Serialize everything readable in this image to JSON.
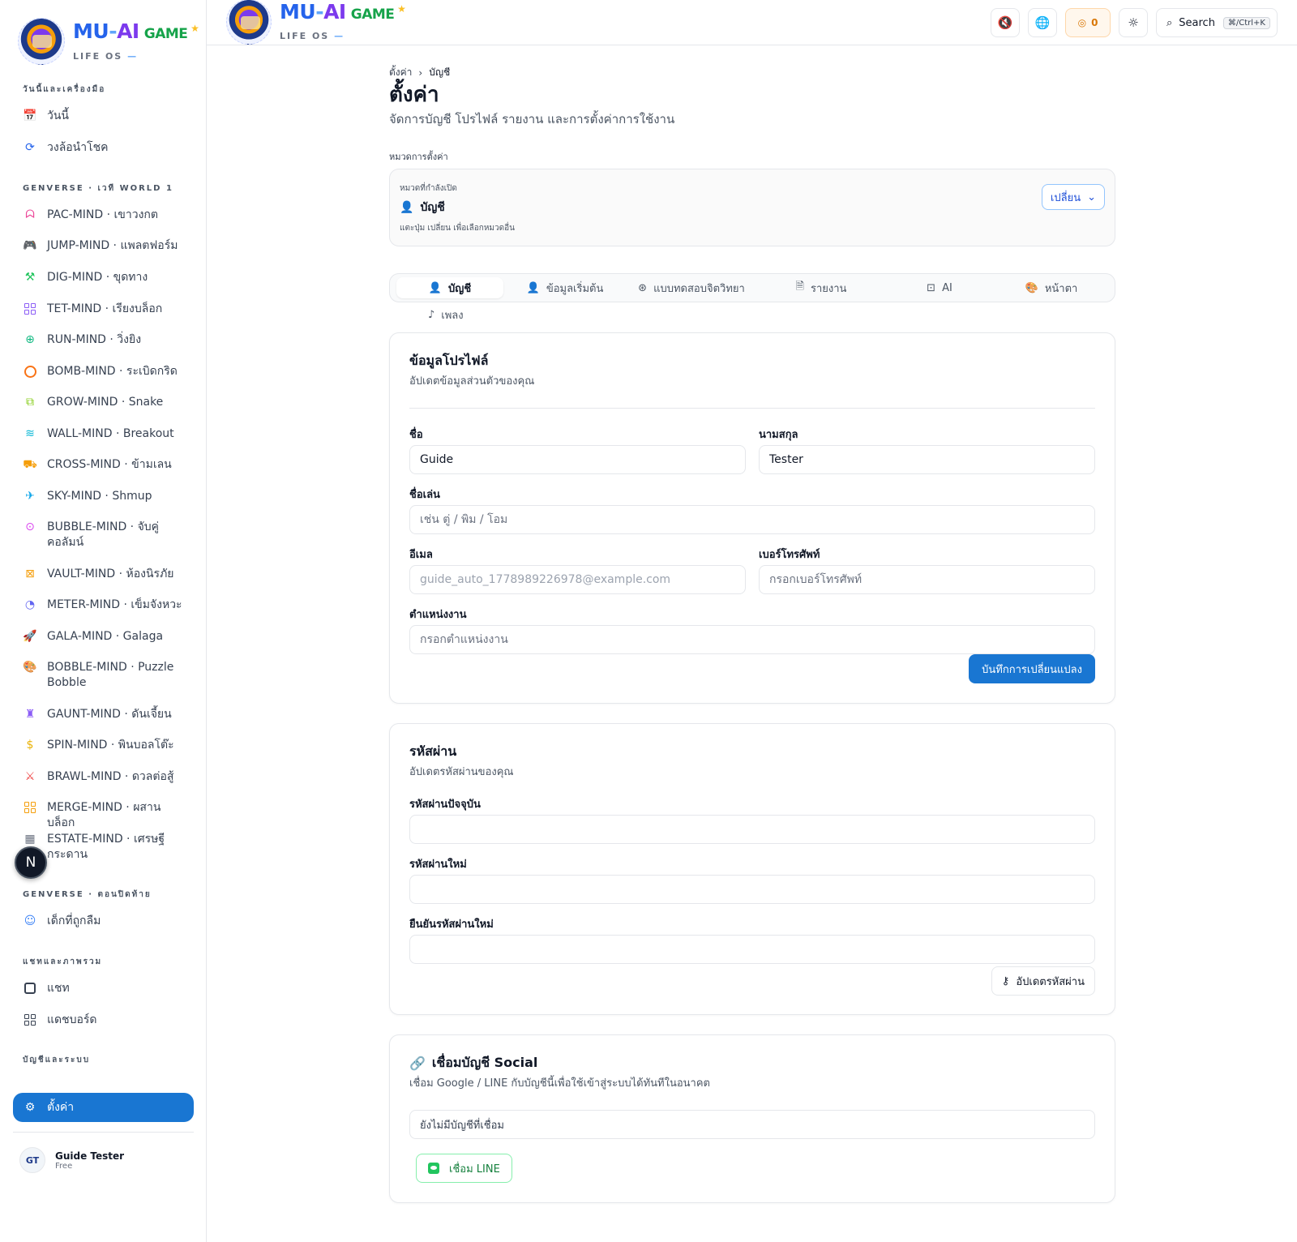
{
  "logo": {
    "mu": "MU",
    "dash": "-",
    "ai": "AI",
    "game": "GAME",
    "sub": "LIFE OS",
    "sub_dash": "—"
  },
  "sidebar": {
    "sections": [
      {
        "label": "วันนี้และเครื่องมือ"
      },
      {
        "label": "GENVERSE · เวที WORLD 1"
      },
      {
        "label": "GENVERSE · ตอนปิดท้าย"
      },
      {
        "label": "แชทและภาพรวม"
      },
      {
        "label": "บัญชีและระบบ"
      }
    ],
    "items": [
      {
        "label": "วันนี้",
        "icon": "calendar-icon",
        "color": "#6b7280"
      },
      {
        "label": "วงล้อนำโชค",
        "icon": "refresh-icon",
        "color": "#2563eb"
      },
      {
        "label": "PAC-MIND · เขาวงกต",
        "icon": "ghost-icon",
        "color": "#ec4899"
      },
      {
        "label": "JUMP-MIND · แพลตฟอร์ม",
        "icon": "gamepad-icon",
        "color": "#ef4444"
      },
      {
        "label": "DIG-MIND · ขุดทาง",
        "icon": "pickaxe-icon",
        "color": "#22c55e"
      },
      {
        "label": "TET-MIND · เรียงบล็อก",
        "icon": "blocks-icon",
        "color": "#8b5cf6"
      },
      {
        "label": "RUN-MIND · วิ่งยิง",
        "icon": "crosshair-icon",
        "color": "#10b981"
      },
      {
        "label": "BOMB-MIND · ระเบิดกริด",
        "icon": "bomb-icon",
        "color": "#f97316"
      },
      {
        "label": "GROW-MIND · Snake",
        "icon": "boxes-icon",
        "color": "#84cc16"
      },
      {
        "label": "WALL-MIND · Breakout",
        "icon": "layers-icon",
        "color": "#06b6d4"
      },
      {
        "label": "CROSS-MIND · ข้ามเลน",
        "icon": "car-icon",
        "color": "#f59e0b"
      },
      {
        "label": "SKY-MIND · Shmup",
        "icon": "plane-icon",
        "color": "#0ea5e9"
      },
      {
        "label": "BUBBLE-MIND · จับคู่คอลัมน์",
        "icon": "circle-dot-icon",
        "color": "#d946ef"
      },
      {
        "label": "VAULT-MIND · ห้องนิรภัย",
        "icon": "vault-icon",
        "color": "#f59e0b"
      },
      {
        "label": "METER-MIND · เข็มจังหวะ",
        "icon": "gauge-icon",
        "color": "#6366f1"
      },
      {
        "label": "GALA-MIND · Galaga",
        "icon": "rocket-icon",
        "color": "#14b8a6"
      },
      {
        "label": "BOBBLE-MIND · Puzzle Bobble",
        "icon": "palette-icon",
        "color": "#ec4899"
      },
      {
        "label": "GAUNT-MIND · ดันเจี้ยน",
        "icon": "castle-icon",
        "color": "#8b5cf6"
      },
      {
        "label": "SPIN-MIND · พินบอลโต๊ะ",
        "icon": "coin-icon",
        "color": "#eab308"
      },
      {
        "label": "BRAWL-MIND · ดวลต่อสู้",
        "icon": "swords-icon",
        "color": "#ef4444"
      },
      {
        "label": "MERGE-MIND · ผสานบล็อก",
        "icon": "merge-icon",
        "color": "#f59e0b"
      },
      {
        "label": "ESTATE-MIND · เศรษฐีกระดาน",
        "icon": "building-icon",
        "color": "#6b7280"
      },
      {
        "label": "เด็กที่ถูกลืม",
        "icon": "smile-icon",
        "color": "#3b82f6"
      },
      {
        "label": "แชท",
        "icon": "chat-icon",
        "color": "#374151"
      },
      {
        "label": "แดชบอร์ด",
        "icon": "dashboard-icon",
        "color": "#374151"
      },
      {
        "label": "ตั้งค่า",
        "icon": "gear-icon",
        "color": "#ffffff"
      }
    ],
    "user": {
      "initials": "GT",
      "name": "Guide Tester",
      "plan": "Free"
    },
    "fab": "N"
  },
  "topbar": {
    "coins": "0",
    "search_label": "Search",
    "shortcut": "⌘/Ctrl+K"
  },
  "breadcrumb": {
    "root": "ตั้งค่า",
    "current": "บัญชี"
  },
  "page": {
    "title": "ตั้งค่า",
    "description": "จัดการบัญชี โปรไฟล์ รายงาน และการตั้งค่าการใช้งาน"
  },
  "category": {
    "section_label": "หมวดการตั้งค่า",
    "current_label": "หมวดที่กำลังเปิด",
    "current": "บัญชี",
    "hint": "แตะปุ่ม เปลี่ยน เพื่อเลือกหมวดอื่น",
    "change_button": "เปลี่ยน"
  },
  "tabs": [
    {
      "label": "บัญชี",
      "icon": "user-icon"
    },
    {
      "label": "ข้อมูลเริ่มต้น",
      "icon": "user-icon"
    },
    {
      "label": "แบบทดสอบจิตวิทยา",
      "icon": "brain-icon"
    },
    {
      "label": "รายงาน",
      "icon": "file-icon"
    },
    {
      "label": "AI",
      "icon": "bot-icon"
    },
    {
      "label": "หน้าตา",
      "icon": "palette-icon"
    },
    {
      "label": "เพลง",
      "icon": "music-icon"
    }
  ],
  "profile": {
    "title": "ข้อมูลโปรไฟล์",
    "subtitle": "อัปเดตข้อมูลส่วนตัวของคุณ",
    "first_name_label": "ชื่อ",
    "first_name": "Guide",
    "last_name_label": "นามสกุล",
    "last_name": "Tester",
    "nickname_label": "ชื่อเล่น",
    "nickname_placeholder": "เช่น ตู่ / พิม / โอม",
    "email_label": "อีเมล",
    "email": "guide_auto_1778989226978@example.com",
    "phone_label": "เบอร์โทรศัพท์",
    "phone_placeholder": "กรอกเบอร์โทรศัพท์",
    "position_label": "ตำแหน่งงาน",
    "position_placeholder": "กรอกตำแหน่งงาน",
    "save_button": "บันทึกการเปลี่ยนแปลง"
  },
  "password": {
    "title": "รหัสผ่าน",
    "subtitle": "อัปเดตรหัสผ่านของคุณ",
    "current_label": "รหัสผ่านปัจจุบัน",
    "new_label": "รหัสผ่านใหม่",
    "confirm_label": "ยืนยันรหัสผ่านใหม่",
    "update_button": "อัปเดตรหัสผ่าน"
  },
  "social": {
    "title": "เชื่อมบัญชี Social",
    "subtitle": "เชื่อม Google / LINE กับบัญชีนี้เพื่อใช้เข้าสู่ระบบได้ทันทีในอนาคต",
    "empty": "ยังไม่มีบัญชีที่เชื่อม",
    "line_button": "เชื่อม LINE"
  }
}
